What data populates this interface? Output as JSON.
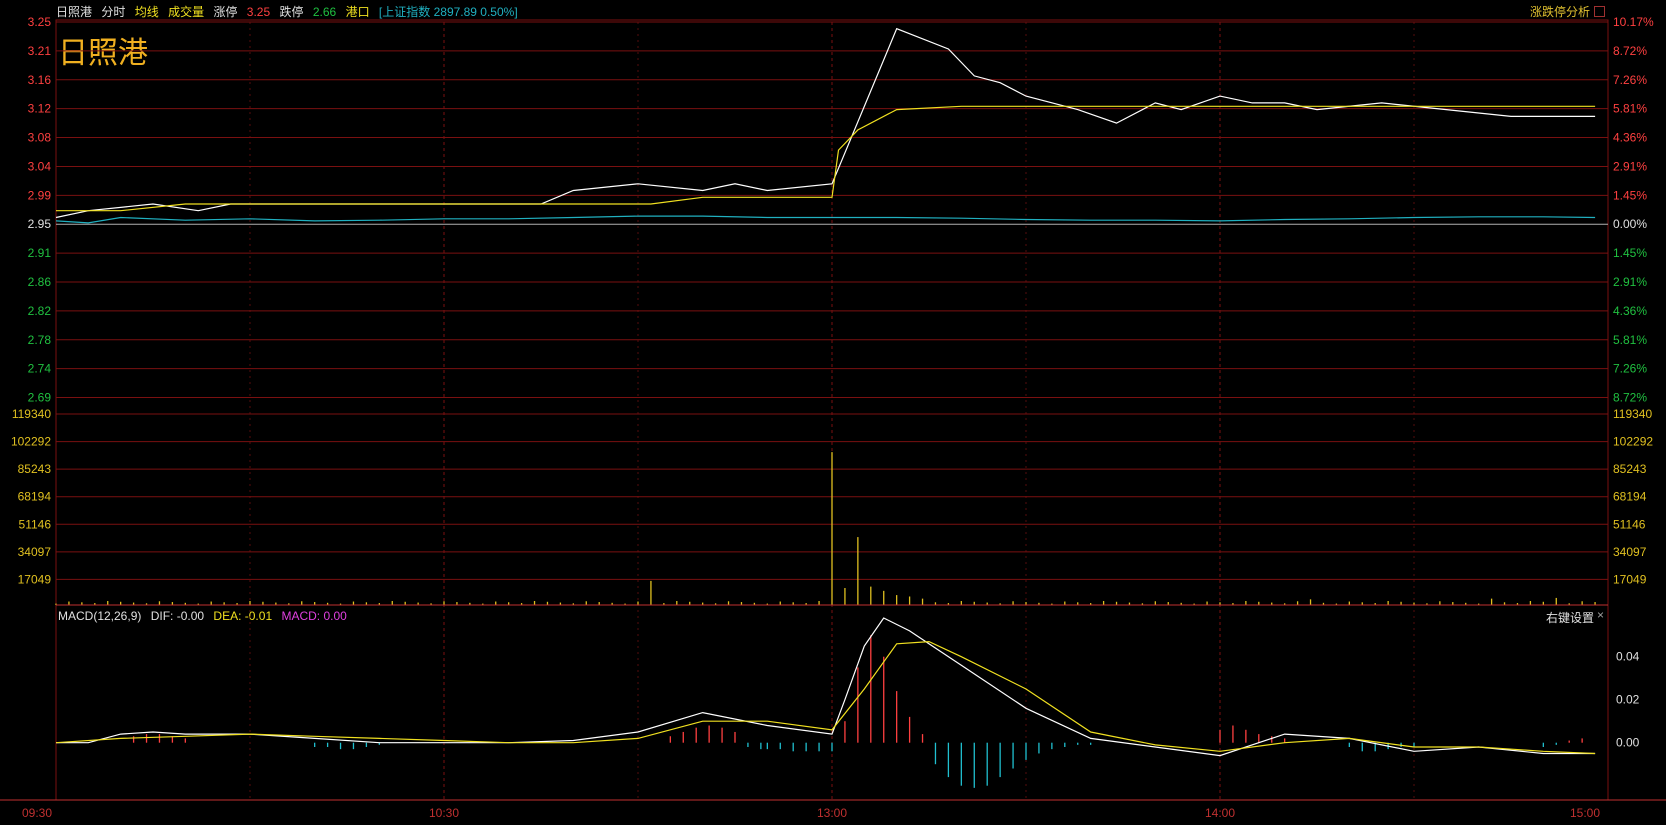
{
  "header": {
    "stock_name": "日照港",
    "mode_label": "分时",
    "avg_label": "均线",
    "volume_label": "成交量",
    "limit_up_label": "涨停",
    "limit_up_value": "3.25",
    "limit_down_label": "跌停",
    "limit_down_value": "2.66",
    "sector_label": "港口",
    "index_text": "[上证指数 2897.89 0.50%]",
    "analysis_label": "涨跌停分析"
  },
  "big_title": "日照港",
  "macd_header": {
    "name": "MACD(12,26,9)",
    "dif": "DIF: -0.00",
    "dea": "DEA: -0.01",
    "macd": "MACD: 0.00",
    "settings_label": "右键设置",
    "close_symbol": "×"
  },
  "colors": {
    "background": "#000000",
    "grid": "#7a1010",
    "price_line": "#ffffff",
    "avg_line": "#f0e020",
    "index_line": "#20b0c0",
    "up_text": "#ff4040",
    "down_text": "#20c040",
    "volume_bar": "#e0c020",
    "macd_pos": "#ff4040",
    "macd_neg": "#20c0d0",
    "dif_line": "#ffffff",
    "dea_line": "#f0e020"
  },
  "chart_data": [
    {
      "type": "line",
      "panel": "price",
      "price_axis_labels": [
        "3.25",
        "3.21",
        "3.16",
        "3.12",
        "3.08",
        "3.04",
        "2.99",
        "2.95",
        "2.91",
        "2.86",
        "2.82",
        "2.78",
        "2.74",
        "2.69"
      ],
      "pct_axis_labels": [
        "10.17%",
        "8.72%",
        "7.26%",
        "5.81%",
        "4.36%",
        "2.91%",
        "1.45%",
        "0.00%",
        "1.45%",
        "2.91%",
        "4.36%",
        "5.81%",
        "7.26%",
        "8.72%"
      ],
      "prev_close": 2.95,
      "ylim": [
        2.69,
        3.25
      ],
      "x_minutes_range": [
        0,
        240
      ],
      "series": [
        {
          "name": "日照港",
          "role": "price",
          "x": [
            0,
            5,
            15,
            22,
            27,
            34,
            38,
            45,
            55,
            60,
            65,
            75,
            80,
            90,
            100,
            105,
            110,
            120,
            130,
            138,
            142,
            146,
            150,
            158,
            164,
            170,
            174,
            180,
            185,
            190,
            195,
            205,
            215,
            225,
            230,
            238
          ],
          "y": [
            2.96,
            2.97,
            2.98,
            2.97,
            2.98,
            2.98,
            2.98,
            2.98,
            2.98,
            2.98,
            2.98,
            2.98,
            3.0,
            3.01,
            3.0,
            3.01,
            3.0,
            3.01,
            3.24,
            3.21,
            3.17,
            3.16,
            3.14,
            3.12,
            3.1,
            3.13,
            3.12,
            3.14,
            3.13,
            3.13,
            3.12,
            3.13,
            3.12,
            3.11,
            3.11,
            3.11
          ]
        },
        {
          "name": "均线",
          "role": "avg",
          "x": [
            0,
            10,
            20,
            40,
            60,
            80,
            92,
            100,
            110,
            120,
            121,
            124,
            130,
            140,
            160,
            180,
            200,
            220,
            238
          ],
          "y": [
            2.97,
            2.97,
            2.98,
            2.98,
            2.98,
            2.98,
            2.98,
            2.99,
            2.99,
            2.99,
            3.06,
            3.09,
            3.12,
            3.125,
            3.125,
            3.125,
            3.125,
            3.125,
            3.125
          ]
        },
        {
          "name": "上证指数",
          "role": "index",
          "x": [
            0,
            5,
            10,
            20,
            30,
            40,
            50,
            60,
            70,
            80,
            90,
            100,
            110,
            120,
            130,
            140,
            150,
            160,
            170,
            180,
            190,
            200,
            210,
            220,
            230,
            238
          ],
          "y": [
            2.955,
            2.952,
            2.96,
            2.956,
            2.958,
            2.955,
            2.956,
            2.958,
            2.958,
            2.96,
            2.962,
            2.962,
            2.96,
            2.96,
            2.96,
            2.959,
            2.957,
            2.956,
            2.956,
            2.955,
            2.957,
            2.958,
            2.96,
            2.961,
            2.961,
            2.96
          ]
        }
      ]
    },
    {
      "type": "bar",
      "panel": "volume",
      "axis_labels": [
        "119340",
        "102292",
        "85243",
        "68194",
        "51146",
        "34097",
        "17049"
      ],
      "ylim": [
        0,
        136389
      ],
      "peaks_x": [
        92,
        93,
        120,
        121,
        122,
        123,
        124,
        125,
        126,
        127,
        128,
        129,
        130,
        132,
        134,
        194,
        222,
        225,
        232
      ],
      "peaks_y": [
        17049,
        16000,
        108000,
        15000,
        12000,
        13000,
        48000,
        18000,
        13000,
        11000,
        10000,
        9000,
        7000,
        6000,
        4500,
        4000,
        4500,
        4000,
        5000
      ],
      "baseline_value": 2000
    },
    {
      "type": "bar",
      "panel": "macd",
      "axis_labels": [
        "0.04",
        "0.02",
        "0.00"
      ],
      "ylim": [
        -0.022,
        0.058
      ],
      "dif_x": [
        0,
        5,
        10,
        15,
        20,
        30,
        40,
        50,
        60,
        70,
        80,
        90,
        100,
        110,
        120,
        122,
        125,
        128,
        132,
        140,
        150,
        160,
        170,
        180,
        190,
        200,
        210,
        220,
        230,
        238
      ],
      "dif_y": [
        0,
        0,
        0.004,
        0.005,
        0.004,
        0.004,
        0.002,
        0,
        0,
        0,
        0.001,
        0.005,
        0.014,
        0.008,
        0.004,
        0.02,
        0.045,
        0.058,
        0.052,
        0.036,
        0.016,
        0.002,
        -0.002,
        -0.006,
        0.004,
        0.002,
        -0.004,
        -0.002,
        -0.005,
        -0.005
      ],
      "dea_x": [
        0,
        10,
        20,
        30,
        40,
        50,
        60,
        70,
        80,
        90,
        100,
        110,
        120,
        125,
        130,
        135,
        140,
        150,
        160,
        170,
        180,
        190,
        200,
        210,
        220,
        230,
        238
      ],
      "dea_y": [
        0,
        0.002,
        0.003,
        0.004,
        0.003,
        0.002,
        0.001,
        0,
        0,
        0.002,
        0.01,
        0.01,
        0.006,
        0.025,
        0.046,
        0.047,
        0.04,
        0.025,
        0.005,
        -0.001,
        -0.004,
        0,
        0.002,
        -0.002,
        -0.002,
        -0.004,
        -0.005
      ],
      "hist_x": [
        12,
        14,
        16,
        18,
        20,
        40,
        42,
        44,
        46,
        48,
        50,
        95,
        97,
        99,
        101,
        103,
        105,
        107,
        109,
        110,
        112,
        114,
        116,
        118,
        120,
        122,
        124,
        126,
        128,
        130,
        132,
        134,
        136,
        138,
        140,
        142,
        144,
        146,
        148,
        150,
        152,
        154,
        156,
        158,
        160,
        180,
        182,
        184,
        186,
        188,
        190,
        200,
        202,
        204,
        206,
        208,
        210,
        230,
        232,
        234,
        236
      ],
      "hist_y": [
        0.003,
        0.004,
        0.004,
        0.003,
        0.002,
        -0.002,
        -0.002,
        -0.003,
        -0.003,
        -0.002,
        -0.001,
        0.003,
        0.005,
        0.007,
        0.008,
        0.007,
        0.005,
        -0.002,
        -0.003,
        -0.003,
        -0.003,
        -0.004,
        -0.004,
        -0.004,
        -0.004,
        0.01,
        0.035,
        0.05,
        0.04,
        0.024,
        0.012,
        0.004,
        -0.01,
        -0.016,
        -0.02,
        -0.021,
        -0.02,
        -0.016,
        -0.012,
        -0.008,
        -0.005,
        -0.003,
        -0.002,
        -0.001,
        -0.001,
        0.006,
        0.008,
        0.006,
        0.004,
        0.003,
        0.002,
        -0.002,
        -0.004,
        -0.004,
        -0.003,
        -0.002,
        -0.002,
        -0.002,
        -0.001,
        0.001,
        0.002
      ]
    }
  ],
  "time_axis": {
    "labels": [
      "09:30",
      "10:30",
      "13:00",
      "14:00",
      "15:00"
    ]
  }
}
